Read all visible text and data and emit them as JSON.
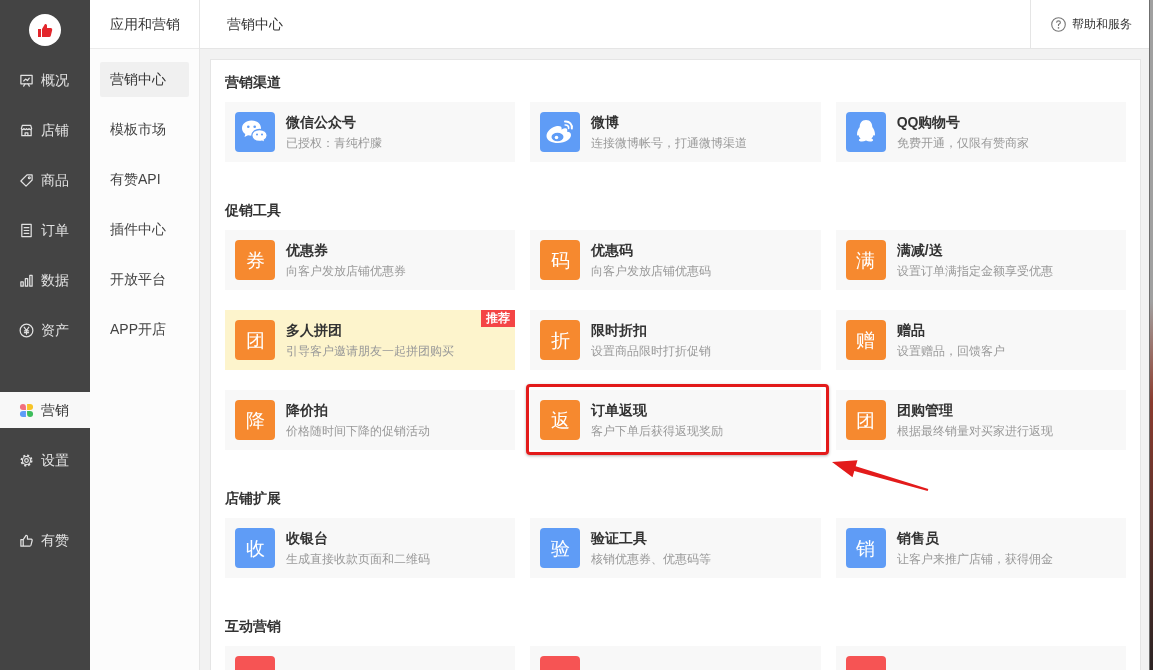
{
  "nav": {
    "groups": [
      {
        "items": [
          {
            "label": "概况",
            "selected": false
          },
          {
            "label": "店铺",
            "selected": false
          },
          {
            "label": "商品",
            "selected": false
          },
          {
            "label": "订单",
            "selected": false
          },
          {
            "label": "数据",
            "selected": false
          },
          {
            "label": "资产",
            "selected": false
          }
        ]
      },
      {
        "items": [
          {
            "label": "营销",
            "selected": true
          },
          {
            "label": "设置",
            "selected": false
          }
        ]
      },
      {
        "items": [
          {
            "label": "有赞",
            "selected": false
          }
        ]
      }
    ]
  },
  "subnav": {
    "title": "应用和营销",
    "items": [
      {
        "label": "营销中心",
        "selected": true
      },
      {
        "label": "模板市场",
        "selected": false
      },
      {
        "label": "有赞API",
        "selected": false
      },
      {
        "label": "插件中心",
        "selected": false
      },
      {
        "label": "开放平台",
        "selected": false
      },
      {
        "label": "APP开店",
        "selected": false
      }
    ]
  },
  "header": {
    "title": "营销中心",
    "help": "帮助和服务"
  },
  "sections": [
    {
      "title": "营销渠道",
      "cards": [
        {
          "kind": "logo",
          "title": "微信公众号",
          "subtitle": "已授权：青纯柠朦",
          "color": "#5f9cf6",
          "featured": false,
          "highlighted": false
        },
        {
          "kind": "logo",
          "title": "微博",
          "subtitle": "连接微博帐号，打通微博渠道",
          "color": "#5f9cf6",
          "featured": false,
          "highlighted": false
        },
        {
          "kind": "logo",
          "title": "QQ购物号",
          "subtitle": "免费开通，仅限有赞商家",
          "color": "#5f9cf6",
          "featured": false,
          "highlighted": false
        }
      ]
    },
    {
      "title": "促销工具",
      "cards": [
        {
          "kind": "glyph",
          "icon": "券",
          "title": "优惠券",
          "subtitle": "向客户发放店铺优惠券",
          "color": "#f6892f",
          "featured": false,
          "highlighted": false
        },
        {
          "kind": "glyph",
          "icon": "码",
          "title": "优惠码",
          "subtitle": "向客户发放店铺优惠码",
          "color": "#f6892f",
          "featured": false,
          "highlighted": false
        },
        {
          "kind": "glyph",
          "icon": "满",
          "title": "满减/送",
          "subtitle": "设置订单满指定金额享受优惠",
          "color": "#f6892f",
          "featured": false,
          "highlighted": false
        },
        {
          "kind": "glyph",
          "icon": "团",
          "title": "多人拼团",
          "subtitle": "引导客户邀请朋友一起拼团购买",
          "color": "#f6892f",
          "featured": true,
          "highlighted": false,
          "badge": "推荐"
        },
        {
          "kind": "glyph",
          "icon": "折",
          "title": "限时折扣",
          "subtitle": "设置商品限时打折促销",
          "color": "#f6892f",
          "featured": false,
          "highlighted": false
        },
        {
          "kind": "glyph",
          "icon": "赠",
          "title": "赠品",
          "subtitle": "设置赠品，回馈客户",
          "color": "#f6892f",
          "featured": false,
          "highlighted": false
        },
        {
          "kind": "glyph",
          "icon": "降",
          "title": "降价拍",
          "subtitle": "价格随时间下降的促销活动",
          "color": "#f6892f",
          "featured": false,
          "highlighted": false
        },
        {
          "kind": "glyph",
          "icon": "返",
          "title": "订单返现",
          "subtitle": "客户下单后获得返现奖励",
          "color": "#f6892f",
          "featured": false,
          "highlighted": true
        },
        {
          "kind": "glyph",
          "icon": "团",
          "title": "团购管理",
          "subtitle": "根据最终销量对买家进行返现",
          "color": "#f6892f",
          "featured": false,
          "highlighted": false
        }
      ]
    },
    {
      "title": "店铺扩展",
      "cards": [
        {
          "kind": "glyph",
          "icon": "收",
          "title": "收银台",
          "subtitle": "生成直接收款页面和二维码",
          "color": "#5f9cf6",
          "featured": false,
          "highlighted": false
        },
        {
          "kind": "glyph",
          "icon": "验",
          "title": "验证工具",
          "subtitle": "核销优惠券、优惠码等",
          "color": "#5f9cf6",
          "featured": false,
          "highlighted": false
        },
        {
          "kind": "glyph",
          "icon": "销",
          "title": "销售员",
          "subtitle": "让客户来推广店铺，获得佣金",
          "color": "#5f9cf6",
          "featured": false,
          "highlighted": false
        }
      ]
    },
    {
      "title": "互动营销",
      "cards": [
        {
          "kind": "glyph",
          "color": "#f65454",
          "featured": false,
          "highlighted": false
        },
        {
          "kind": "glyph",
          "color": "#f65454",
          "featured": false,
          "highlighted": false
        },
        {
          "kind": "glyph",
          "color": "#f65454",
          "featured": false,
          "highlighted": false
        }
      ]
    }
  ]
}
